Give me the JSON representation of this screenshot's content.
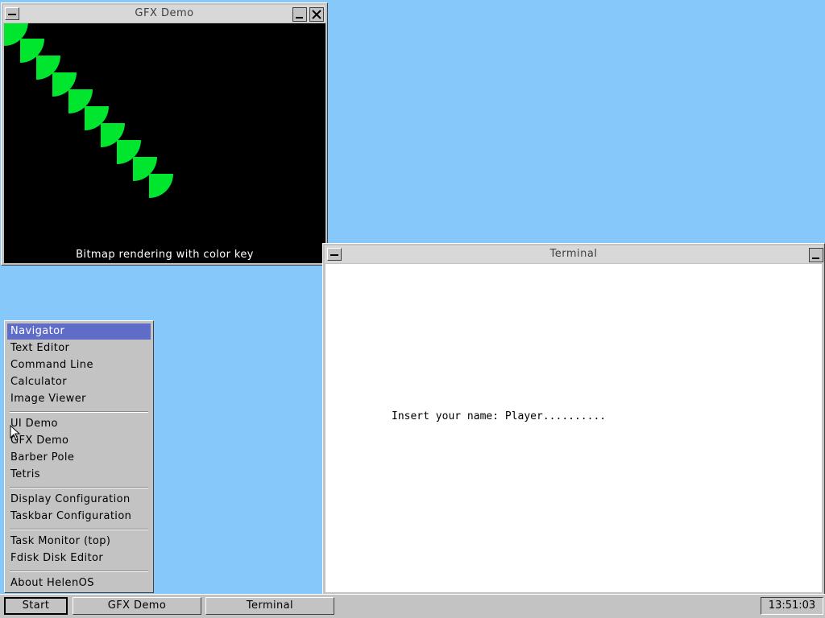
{
  "gfx_window": {
    "title": "GFX Demo",
    "caption": "Bitmap rendering with color key"
  },
  "terminal_window": {
    "title": "Terminal",
    "text": "Insert your name: Player.........."
  },
  "start_menu": {
    "items": [
      {
        "label": "Navigator",
        "selected": true
      },
      {
        "label": "Text Editor"
      },
      {
        "label": "Command Line"
      },
      {
        "label": "Calculator"
      },
      {
        "label": "Image Viewer"
      },
      {
        "label": "UI Demo"
      },
      {
        "label": "GFX Demo"
      },
      {
        "label": "Barber Pole"
      },
      {
        "label": "Tetris"
      },
      {
        "label": "Display Configuration"
      },
      {
        "label": "Taskbar Configuration"
      },
      {
        "label": "Task Monitor (top)"
      },
      {
        "label": "Fdisk Disk Editor"
      },
      {
        "label": "About HelenOS"
      }
    ]
  },
  "taskbar": {
    "start_label": "Start",
    "tasks": [
      "GFX Demo",
      "Terminal"
    ],
    "clock": "13:51:03"
  },
  "colors": {
    "desktop": "#86c8fa",
    "selection": "#5f6dc9",
    "shape_fill": "#00e62e"
  },
  "icons": [
    "window-menu-icon",
    "minimize-icon",
    "close-icon",
    "mouse-cursor-icon"
  ]
}
